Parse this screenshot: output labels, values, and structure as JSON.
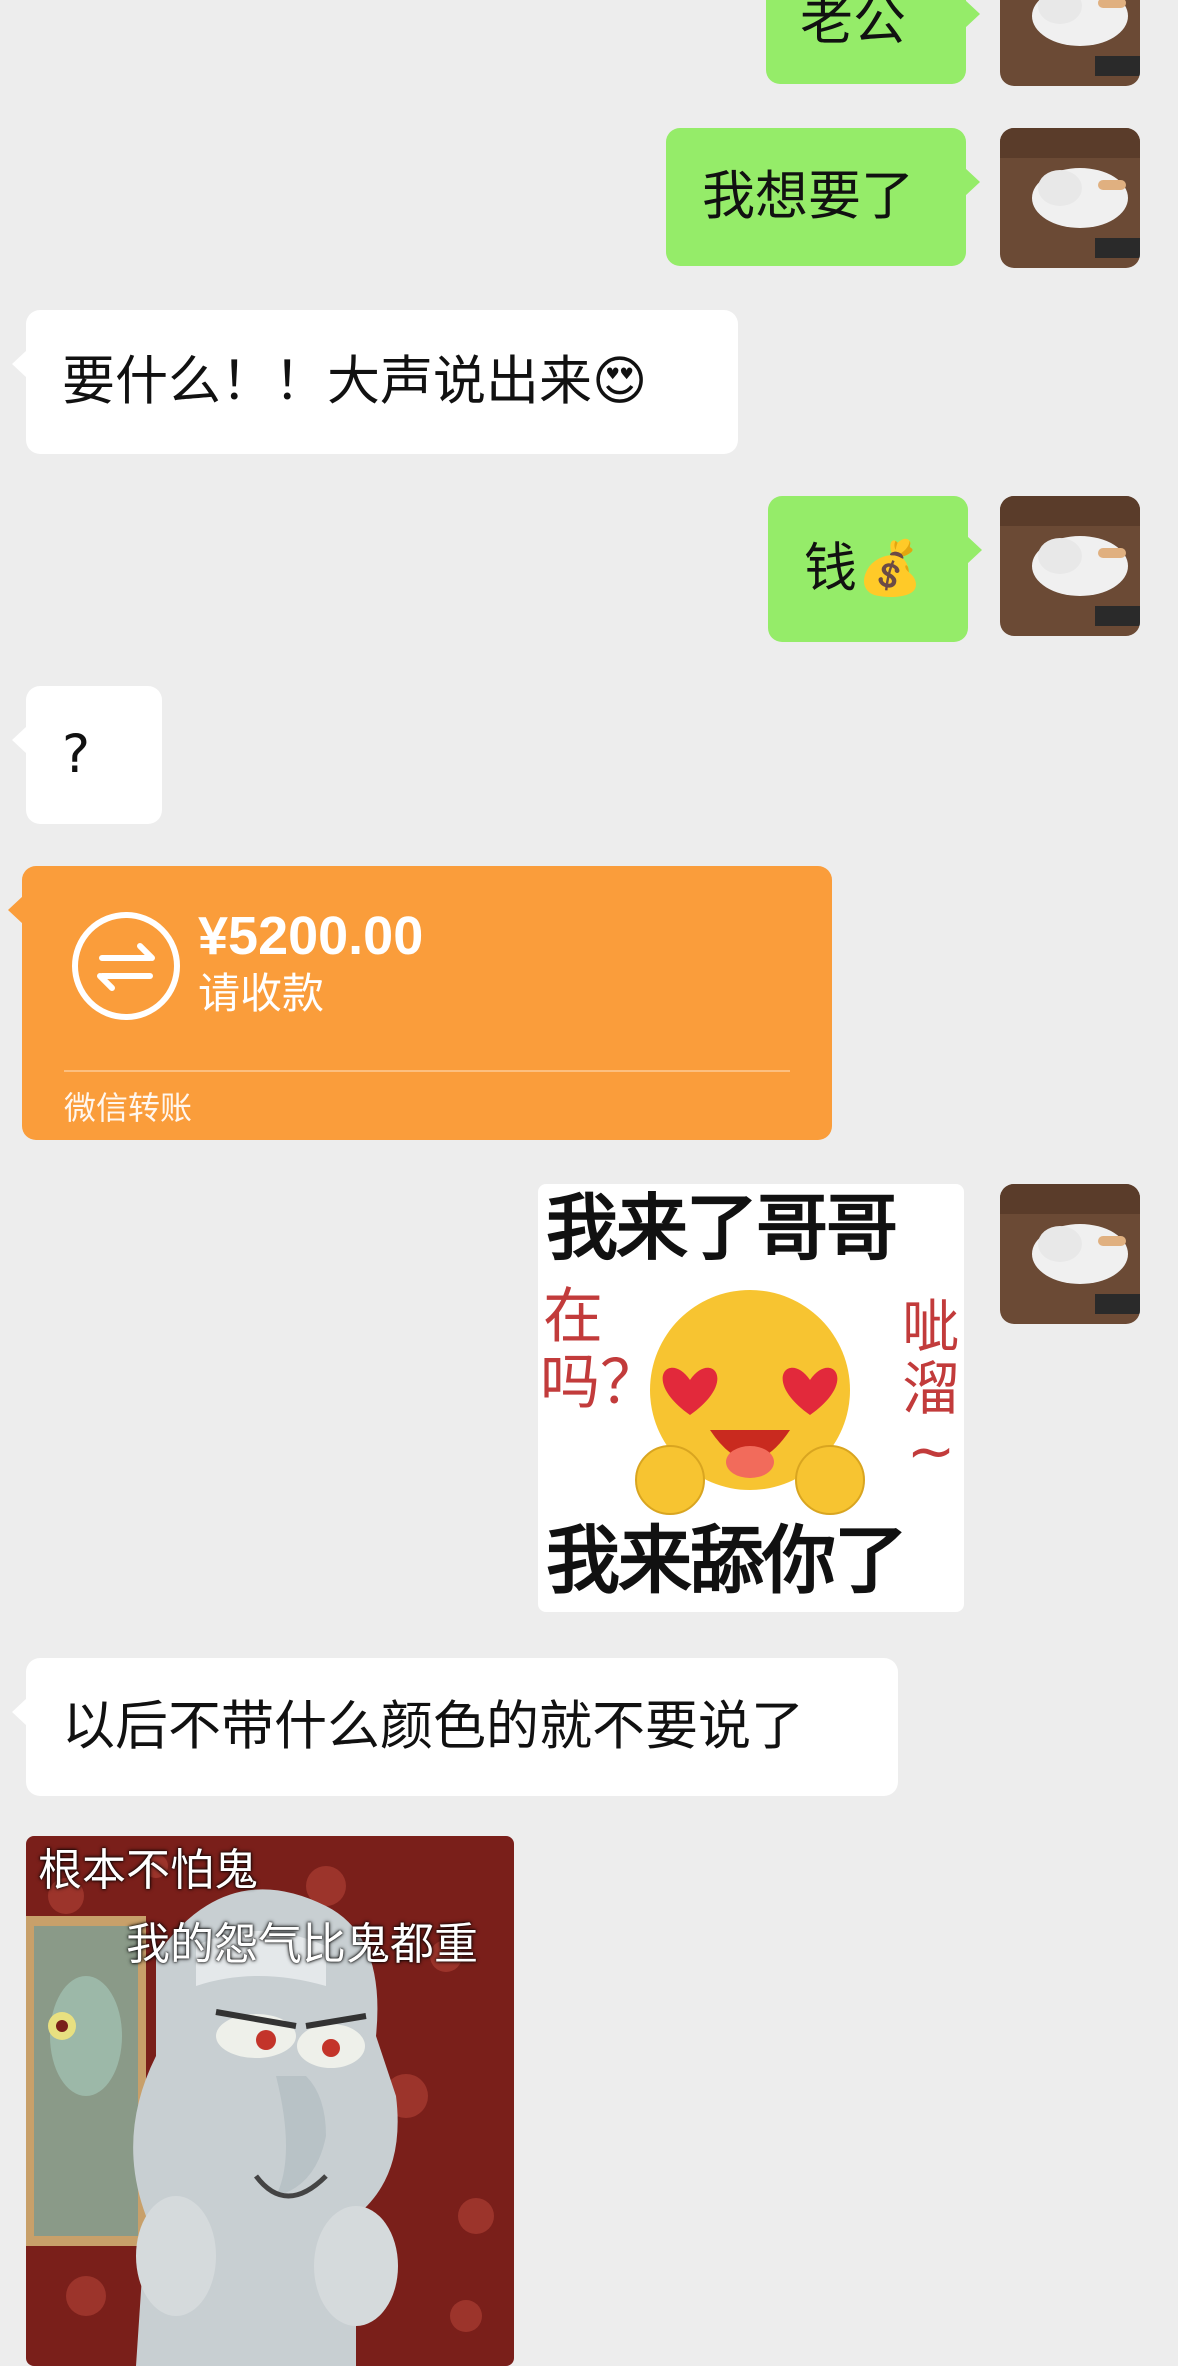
{
  "messages": [
    {
      "id": "m1",
      "side": "out",
      "text": "老公"
    },
    {
      "id": "m2",
      "side": "out",
      "text": "我想要了"
    },
    {
      "id": "m3",
      "side": "in",
      "text": "要什么！！大声说出来😍"
    },
    {
      "id": "m4",
      "side": "out",
      "text": "钱💰"
    },
    {
      "id": "m5",
      "side": "in",
      "text": "?"
    },
    {
      "id": "m6",
      "side": "in",
      "type": "transfer"
    },
    {
      "id": "m7",
      "side": "out",
      "type": "sticker"
    },
    {
      "id": "m8",
      "side": "in",
      "text": "以后不带什么颜色的就不要说了"
    },
    {
      "id": "m9",
      "side": "in",
      "type": "image"
    }
  ],
  "transfer": {
    "amount": "¥5200.00",
    "status": "请收款",
    "source": "微信转账",
    "icon": "transfer-arrows-icon",
    "color": "#fa9d3b"
  },
  "sticker": {
    "top_text": "我来了哥哥",
    "left_text": "在吗？",
    "right_text": "呲溜~",
    "bottom_text": "我来舔你了",
    "icon": "heart-eyes-face-icon"
  },
  "meme": {
    "caption1": "根本不怕鬼",
    "caption2": "我的怨气比鬼都重"
  },
  "colors": {
    "background": "#ededed",
    "outgoing_bubble": "#95ec69",
    "incoming_bubble": "#ffffff"
  }
}
